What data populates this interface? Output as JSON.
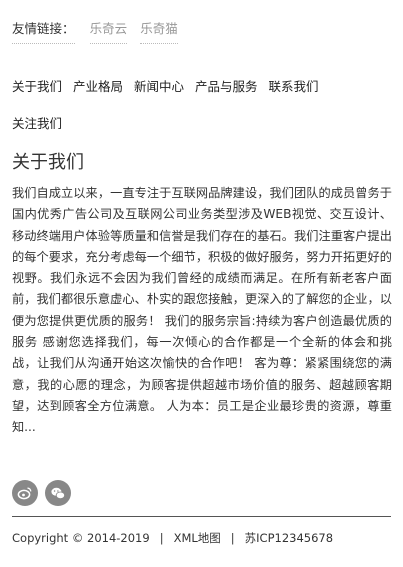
{
  "friend_links": {
    "label": "友情链接：",
    "links": [
      "乐奇云",
      "乐奇猫"
    ]
  },
  "nav": {
    "items": [
      "关于我们",
      "产业格局",
      "新闻中心",
      "产品与服务",
      "联系我们",
      "关注我们"
    ]
  },
  "about": {
    "title": "关于我们",
    "body": "我们自成立以来，一直专注于互联网品牌建设，我们团队的成员曾务于国内优秀广告公司及互联网公司业务类型涉及WEB视觉、交互设计、移动终端用户体验等质量和信誉是我们存在的基石。我们注重客户提出的每个要求，充分考虑每一个细节，积极的做好服务，努力开拓更好的视野。我们永远不会因为我们曾经的成绩而满足。在所有新老客户面前，我们都很乐意虚心、朴实的跟您接触，更深入的了解您的企业，以便为您提供更优质的服务！ 我们的服务宗旨:持续为客户创造最优质的服务 感谢您选择我们，每一次倾心的合作都是一个全新的体会和挑战，让我们从沟通开始这次愉快的合作吧！ 客为尊：紧紧围绕您的满意，我的心愿的理念，为顾客提供超越市场价值的服务、超越顾客期望，达到顾客全方位满意。 人为本：员工是企业最珍贵的资源，尊重知..."
  },
  "social": {
    "icons": [
      "weibo-icon",
      "wechat-icon"
    ]
  },
  "footer": {
    "copyright": "Copyright © 2014-2019",
    "sitemap": "XML地图",
    "icp": "苏ICP12345678",
    "separator": "|"
  }
}
